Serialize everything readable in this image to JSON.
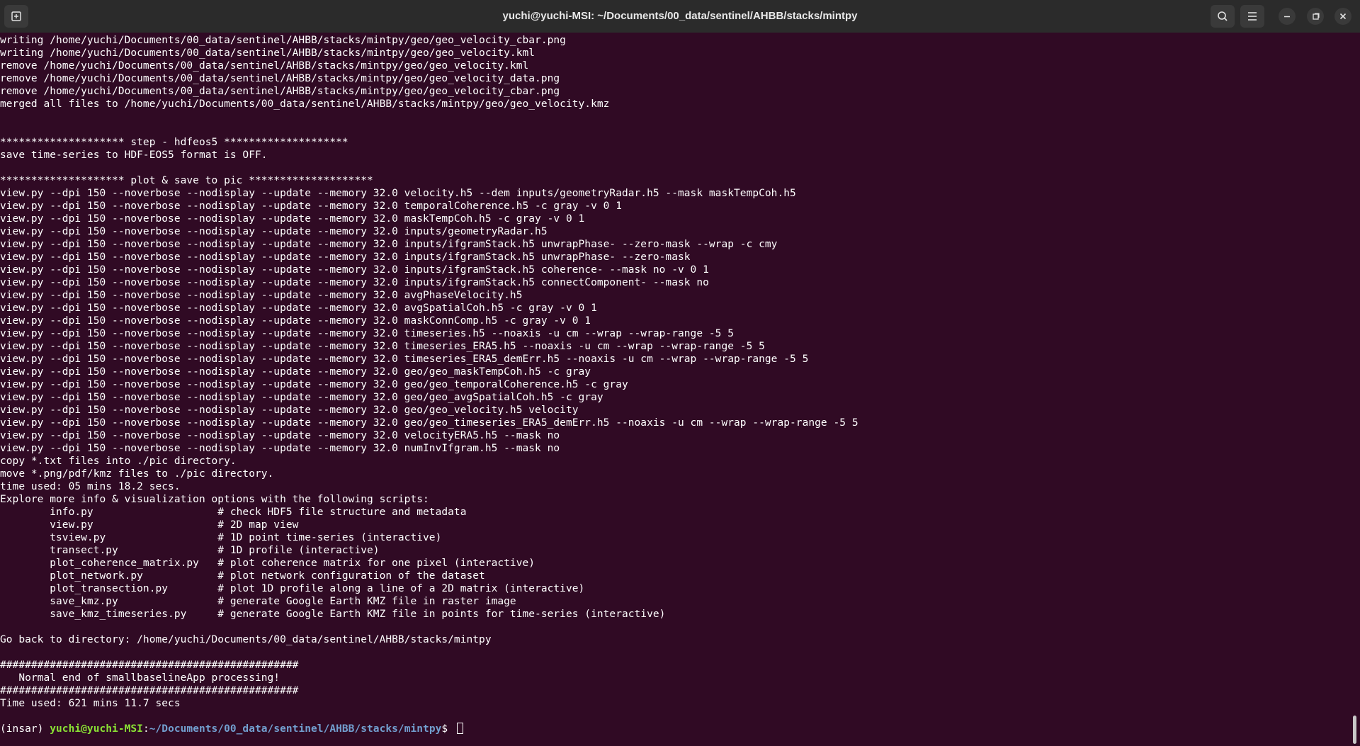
{
  "window": {
    "title": "yuchi@yuchi-MSI: ~/Documents/00_data/sentinel/AHBB/stacks/mintpy"
  },
  "icons": {
    "new_tab": "new-tab-icon",
    "search": "search-icon",
    "menu": "hamburger-menu-icon",
    "minimize": "minimize-icon",
    "maximize": "maximize-icon",
    "close": "close-icon"
  },
  "colors": {
    "terminal_background": "#300a24",
    "titlebar_background": "#2b2b2b",
    "text": "#ffffff",
    "prompt_user": "#8ae234",
    "prompt_path": "#729fcf"
  },
  "terminal": {
    "lines": [
      "writing /home/yuchi/Documents/00_data/sentinel/AHBB/stacks/mintpy/geo/geo_velocity_cbar.png",
      "writing /home/yuchi/Documents/00_data/sentinel/AHBB/stacks/mintpy/geo/geo_velocity.kml",
      "remove /home/yuchi/Documents/00_data/sentinel/AHBB/stacks/mintpy/geo/geo_velocity.kml",
      "remove /home/yuchi/Documents/00_data/sentinel/AHBB/stacks/mintpy/geo/geo_velocity_data.png",
      "remove /home/yuchi/Documents/00_data/sentinel/AHBB/stacks/mintpy/geo/geo_velocity_cbar.png",
      "merged all files to /home/yuchi/Documents/00_data/sentinel/AHBB/stacks/mintpy/geo/geo_velocity.kmz",
      "",
      "",
      "******************** step - hdfeos5 ********************",
      "save time-series to HDF-EOS5 format is OFF.",
      "",
      "******************** plot & save to pic ********************",
      "view.py --dpi 150 --noverbose --nodisplay --update --memory 32.0 velocity.h5 --dem inputs/geometryRadar.h5 --mask maskTempCoh.h5",
      "view.py --dpi 150 --noverbose --nodisplay --update --memory 32.0 temporalCoherence.h5 -c gray -v 0 1",
      "view.py --dpi 150 --noverbose --nodisplay --update --memory 32.0 maskTempCoh.h5 -c gray -v 0 1",
      "view.py --dpi 150 --noverbose --nodisplay --update --memory 32.0 inputs/geometryRadar.h5",
      "view.py --dpi 150 --noverbose --nodisplay --update --memory 32.0 inputs/ifgramStack.h5 unwrapPhase- --zero-mask --wrap -c cmy",
      "view.py --dpi 150 --noverbose --nodisplay --update --memory 32.0 inputs/ifgramStack.h5 unwrapPhase- --zero-mask",
      "view.py --dpi 150 --noverbose --nodisplay --update --memory 32.0 inputs/ifgramStack.h5 coherence- --mask no -v 0 1",
      "view.py --dpi 150 --noverbose --nodisplay --update --memory 32.0 inputs/ifgramStack.h5 connectComponent- --mask no",
      "view.py --dpi 150 --noverbose --nodisplay --update --memory 32.0 avgPhaseVelocity.h5",
      "view.py --dpi 150 --noverbose --nodisplay --update --memory 32.0 avgSpatialCoh.h5 -c gray -v 0 1",
      "view.py --dpi 150 --noverbose --nodisplay --update --memory 32.0 maskConnComp.h5 -c gray -v 0 1",
      "view.py --dpi 150 --noverbose --nodisplay --update --memory 32.0 timeseries.h5 --noaxis -u cm --wrap --wrap-range -5 5",
      "view.py --dpi 150 --noverbose --nodisplay --update --memory 32.0 timeseries_ERA5.h5 --noaxis -u cm --wrap --wrap-range -5 5",
      "view.py --dpi 150 --noverbose --nodisplay --update --memory 32.0 timeseries_ERA5_demErr.h5 --noaxis -u cm --wrap --wrap-range -5 5",
      "view.py --dpi 150 --noverbose --nodisplay --update --memory 32.0 geo/geo_maskTempCoh.h5 -c gray",
      "view.py --dpi 150 --noverbose --nodisplay --update --memory 32.0 geo/geo_temporalCoherence.h5 -c gray",
      "view.py --dpi 150 --noverbose --nodisplay --update --memory 32.0 geo/geo_avgSpatialCoh.h5 -c gray",
      "view.py --dpi 150 --noverbose --nodisplay --update --memory 32.0 geo/geo_velocity.h5 velocity",
      "view.py --dpi 150 --noverbose --nodisplay --update --memory 32.0 geo/geo_timeseries_ERA5_demErr.h5 --noaxis -u cm --wrap --wrap-range -5 5",
      "view.py --dpi 150 --noverbose --nodisplay --update --memory 32.0 velocityERA5.h5 --mask no",
      "view.py --dpi 150 --noverbose --nodisplay --update --memory 32.0 numInvIfgram.h5 --mask no",
      "copy *.txt files into ./pic directory.",
      "move *.png/pdf/kmz files to ./pic directory.",
      "time used: 05 mins 18.2 secs.",
      "Explore more info & visualization options with the following scripts:",
      "        info.py                    # check HDF5 file structure and metadata",
      "        view.py                    # 2D map view",
      "        tsview.py                  # 1D point time-series (interactive)",
      "        transect.py                # 1D profile (interactive)",
      "        plot_coherence_matrix.py   # plot coherence matrix for one pixel (interactive)",
      "        plot_network.py            # plot network configuration of the dataset",
      "        plot_transection.py        # plot 1D profile along a line of a 2D matrix (interactive)",
      "        save_kmz.py                # generate Google Earth KMZ file in raster image",
      "        save_kmz_timeseries.py     # generate Google Earth KMZ file in points for time-series (interactive)",
      "",
      "Go back to directory: /home/yuchi/Documents/00_data/sentinel/AHBB/stacks/mintpy",
      "",
      "################################################",
      "   Normal end of smallbaselineApp processing!",
      "################################################",
      "Time used: 621 mins 11.7 secs",
      ""
    ],
    "prompt": {
      "env": "(insar) ",
      "user_host": "yuchi@yuchi-MSI",
      "colon": ":",
      "path": "~/Documents/00_data/sentinel/AHBB/stacks/mintpy",
      "symbol": "$ "
    }
  }
}
